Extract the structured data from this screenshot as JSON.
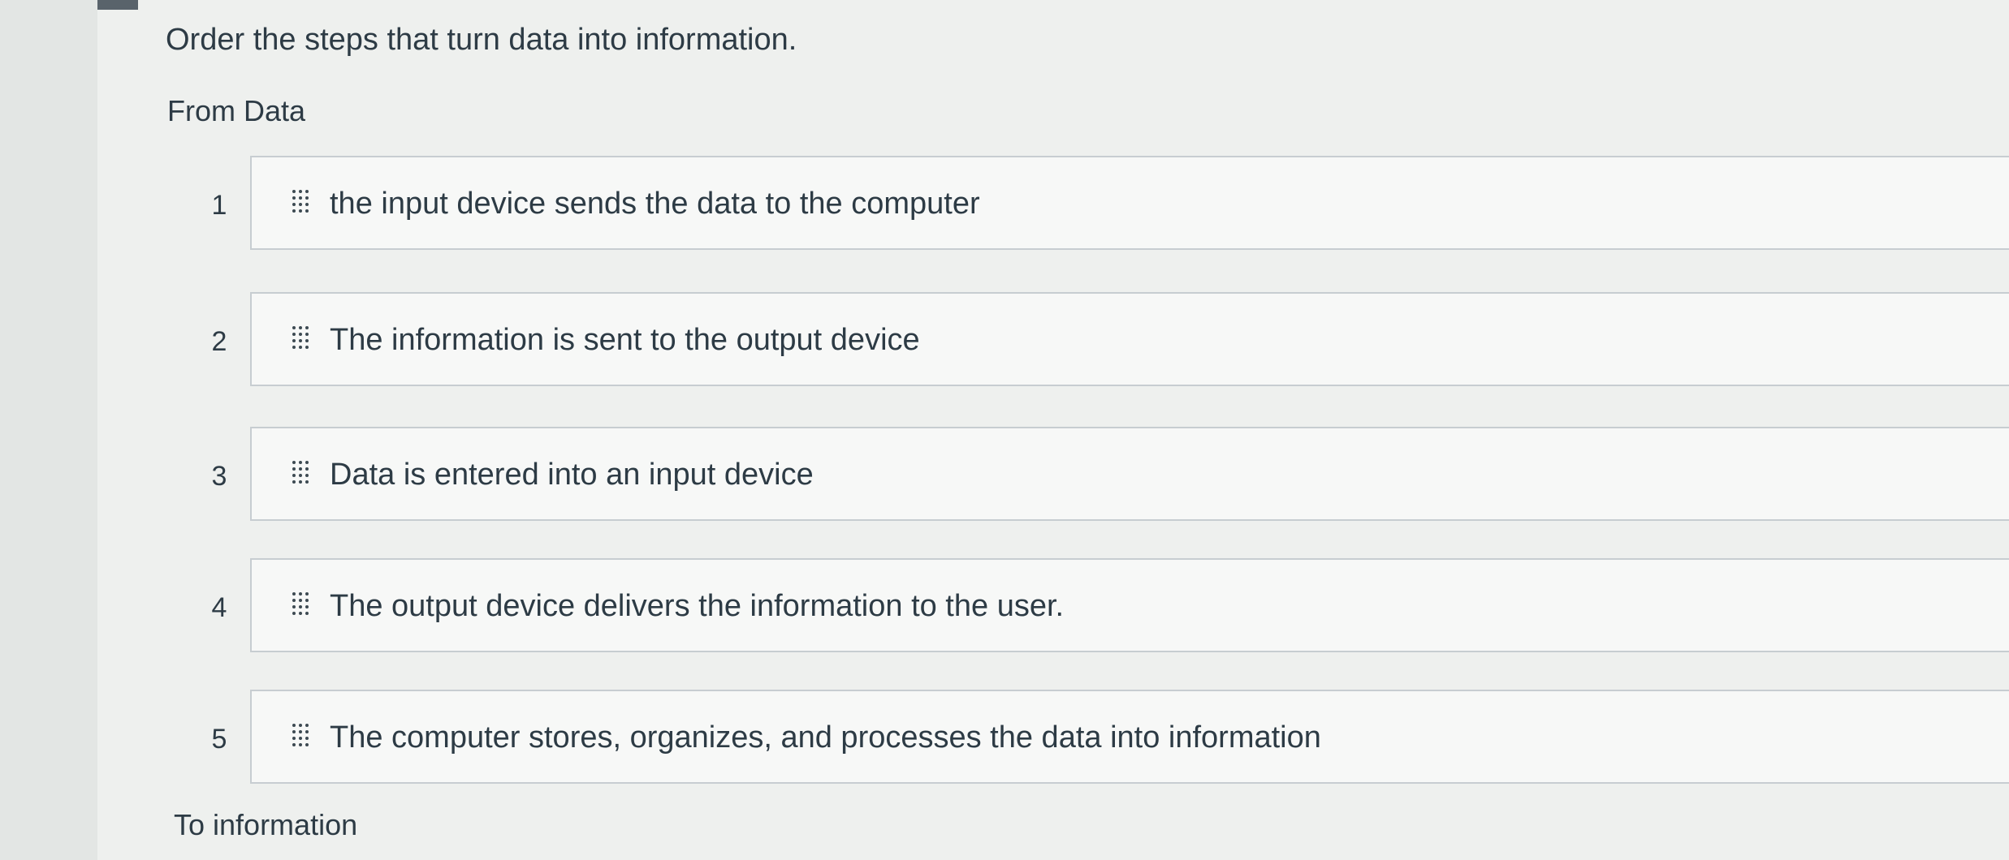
{
  "question": {
    "prompt": "Order the steps that turn data into information.",
    "start_label": "From Data",
    "end_label": "To information"
  },
  "steps": [
    {
      "number": "1",
      "text": "the input device sends the data to the computer",
      "handle_icon": "drag-handle-icon"
    },
    {
      "number": "2",
      "text": "The information is sent to the output device",
      "handle_icon": "drag-handle-icon"
    },
    {
      "number": "3",
      "text": "Data is entered into an input device",
      "handle_icon": "drag-handle-icon"
    },
    {
      "number": "4",
      "text": "The output device delivers the information to the user.",
      "handle_icon": "drag-handle-icon"
    },
    {
      "number": "5",
      "text": "The computer stores, organizes, and processes the data into information",
      "handle_icon": "drag-handle-icon"
    }
  ],
  "colors": {
    "background": "#eef0ee",
    "card_background": "#f7f8f7",
    "card_border": "#c7cdd1",
    "text": "#2d3b45"
  }
}
